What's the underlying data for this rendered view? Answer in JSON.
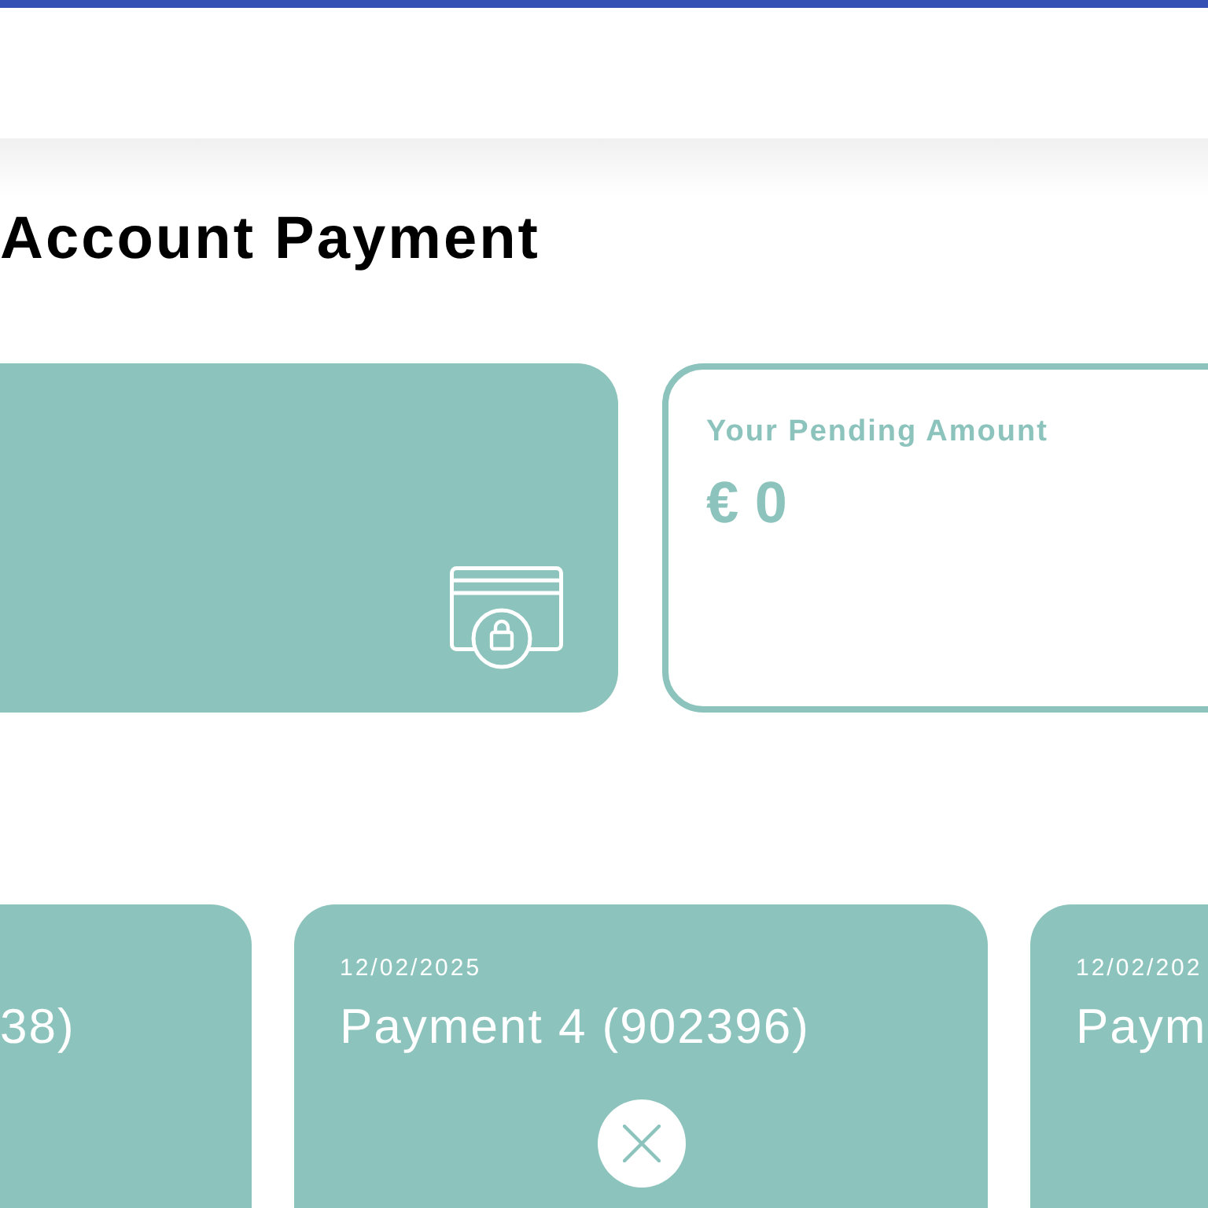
{
  "page_title": "Account Payment",
  "summary": {
    "label": "Your Pending Amount",
    "amount": "€ 0"
  },
  "payments": [
    {
      "title": "38)",
      "dismissible": false
    },
    {
      "date": "12/02/2025",
      "title": "Payment 4 (902396)",
      "dismissible": true
    },
    {
      "date": "12/02/202",
      "title": "Paym",
      "dismissible": false
    }
  ]
}
